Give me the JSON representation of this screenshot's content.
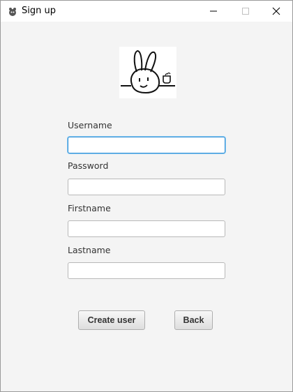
{
  "window": {
    "title": "Sign up"
  },
  "form": {
    "username_label": "Username",
    "username_value": "",
    "password_label": "Password",
    "password_value": "",
    "firstname_label": "Firstname",
    "firstname_value": "",
    "lastname_label": "Lastname",
    "lastname_value": ""
  },
  "actions": {
    "create_label": "Create user",
    "back_label": "Back"
  },
  "colors": {
    "focus_border": "#2f8fd6",
    "background": "#f4f4f4"
  },
  "icons": {
    "app": "app-icon",
    "logo": "rabbit-logo"
  }
}
